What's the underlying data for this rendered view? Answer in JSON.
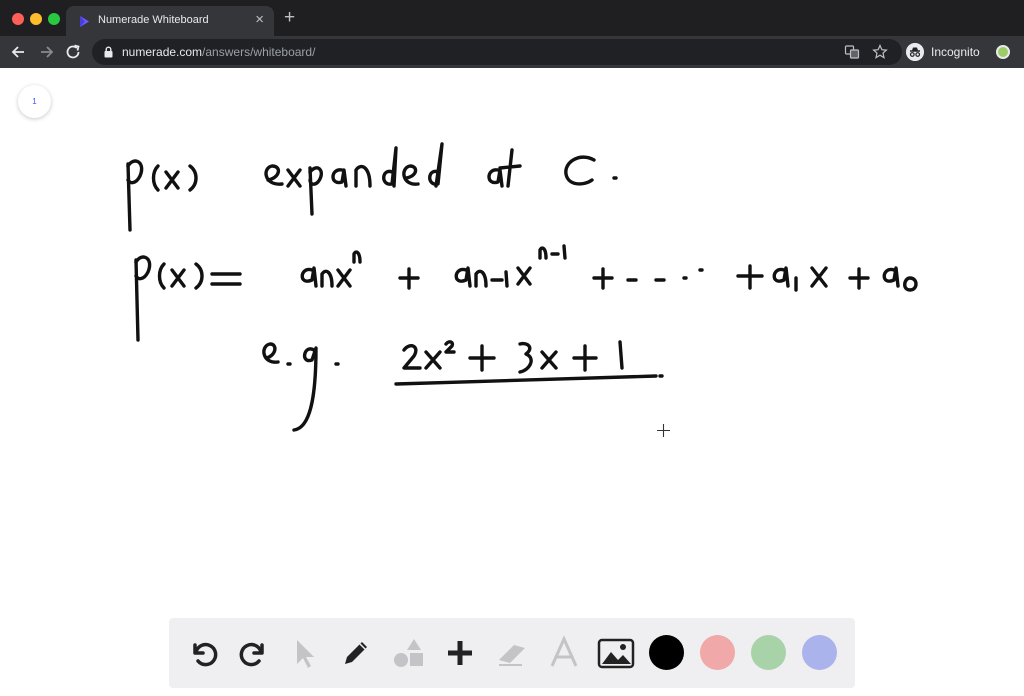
{
  "browser": {
    "tab_title": "Numerade Whiteboard",
    "tab_close": "×",
    "new_tab": "+",
    "url_host": "numerade.com",
    "url_path": "/answers/whiteboard/",
    "profile_label": "Incognito"
  },
  "whiteboard": {
    "page_number": "1",
    "handwriting": {
      "line1": "p(x) expanded at c.",
      "line2": "p(x) = a_n x^n + a_{n-1} x^{n-1} + ... + a_1 x + a_0",
      "line3": "e.g. 2x^2 + 3x + 1"
    }
  },
  "toolbar": {
    "tools": [
      "undo-icon",
      "redo-icon",
      "select-icon",
      "pen-icon",
      "shapes-icon",
      "add-icon",
      "eraser-icon",
      "text-icon",
      "image-icon"
    ],
    "colors": [
      "#000000",
      "#f0a8a8",
      "#a8d3a8",
      "#aab3ec"
    ]
  }
}
